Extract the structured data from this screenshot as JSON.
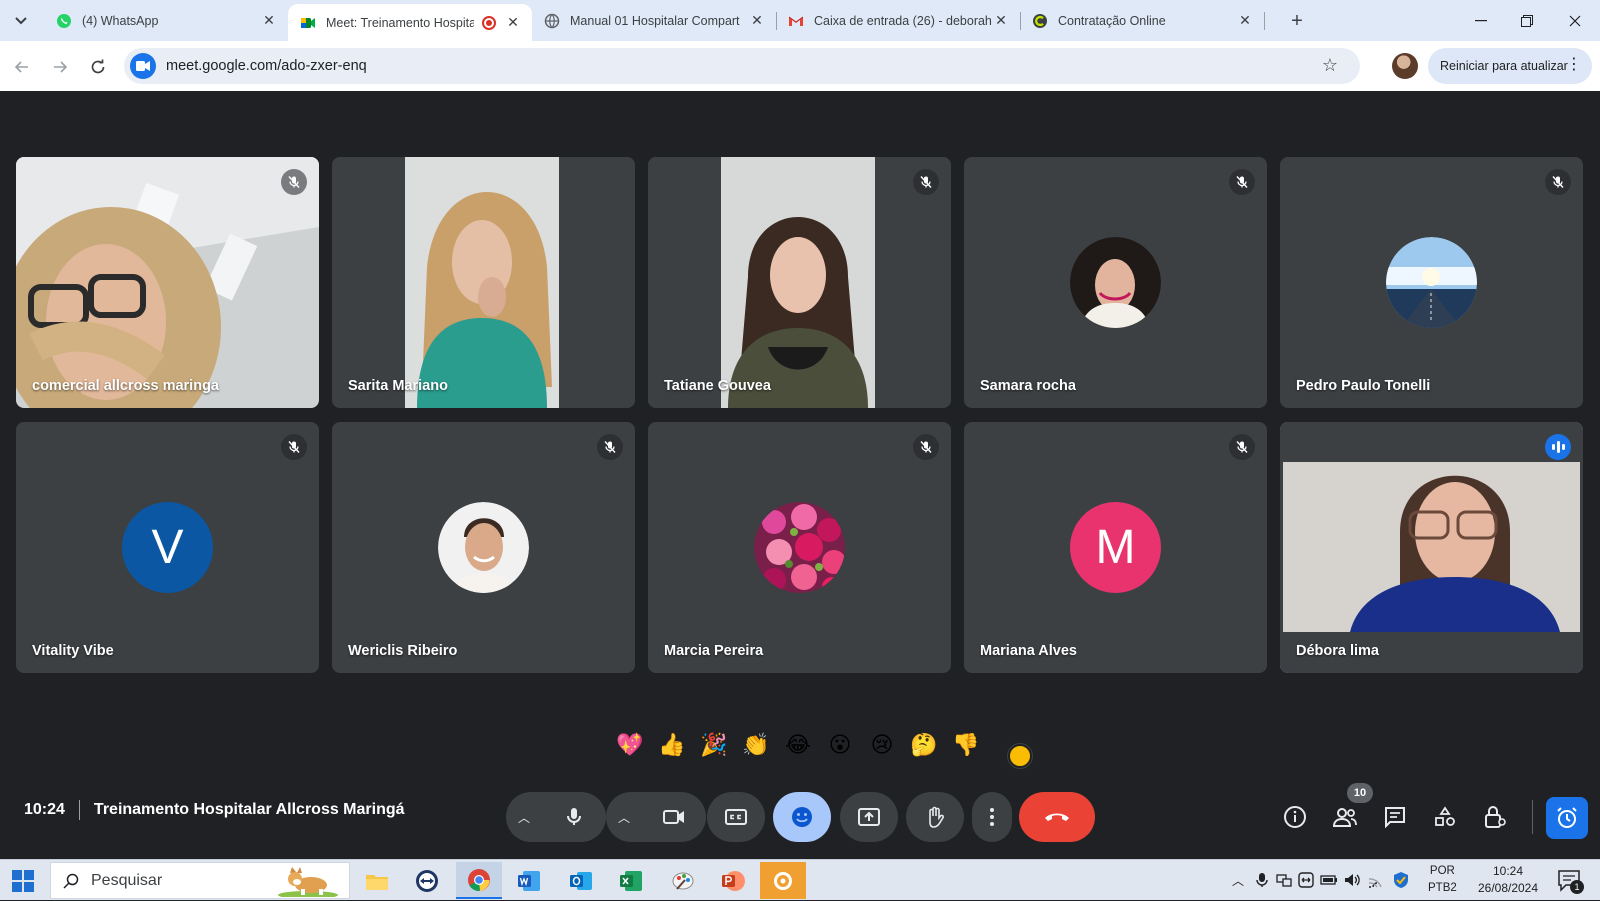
{
  "browser": {
    "tabs": [
      {
        "title": "(4) WhatsApp",
        "icon": "whatsapp-icon",
        "active": false
      },
      {
        "title": "Meet: Treinamento Hospitalar",
        "icon": "google-meet-icon",
        "active": true,
        "recording": true
      },
      {
        "title": "Manual 01 Hospitalar Compart",
        "icon": "globe-icon",
        "active": false
      },
      {
        "title": "Caixa de entrada (26) - deborah",
        "icon": "gmail-icon",
        "active": false
      },
      {
        "title": "Contratação Online",
        "icon": "site-icon",
        "active": false
      }
    ],
    "url": "meet.google.com/ado-zxer-enq",
    "update_button": "Reiniciar para atualizar"
  },
  "participants": [
    {
      "name": "comercial allcross maringa",
      "muted": true,
      "mode": "video"
    },
    {
      "name": "Sarita Mariano",
      "muted": false,
      "mode": "video"
    },
    {
      "name": "Tatiane Gouvea",
      "muted": true,
      "mode": "video"
    },
    {
      "name": "Samara rocha",
      "muted": true,
      "mode": "photo"
    },
    {
      "name": "Pedro Paulo Tonelli",
      "muted": true,
      "mode": "photo"
    },
    {
      "name": "Vitality Vibe",
      "muted": true,
      "mode": "initial",
      "initial": "V",
      "color": "#0b57a4"
    },
    {
      "name": "Wericlis Ribeiro",
      "muted": true,
      "mode": "photo"
    },
    {
      "name": "Marcia Pereira",
      "muted": true,
      "mode": "photo"
    },
    {
      "name": "Mariana Alves",
      "muted": true,
      "mode": "initial",
      "initial": "M",
      "color": "#e8336e"
    },
    {
      "name": "Débora lima",
      "muted": false,
      "speaking": true,
      "mode": "video"
    }
  ],
  "reactions": [
    "💖",
    "👍",
    "🎉",
    "👏",
    "😂",
    "😮",
    "😢",
    "🤔",
    "👎"
  ],
  "meeting": {
    "time": "10:24",
    "title": "Treinamento Hospitalar Allcross Maringá",
    "people_count": "10"
  },
  "taskbar": {
    "search_placeholder": "Pesquisar",
    "language": "POR",
    "keyboard": "PTB2",
    "time": "10:24",
    "date": "26/08/2024",
    "notifications": "1"
  },
  "colors": {
    "accent": "#1a73e8",
    "leave": "#ea4335",
    "tile": "#3c4043",
    "stage": "#202124"
  }
}
